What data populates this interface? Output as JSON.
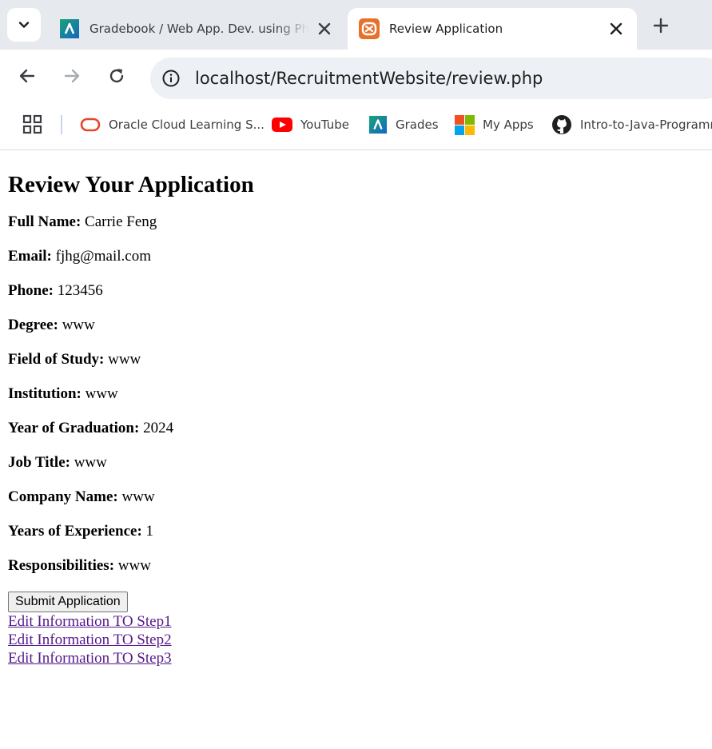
{
  "browser": {
    "tabs": [
      {
        "title": "Gradebook / Web App. Dev. using PhP",
        "active": false
      },
      {
        "title": "Review Application",
        "active": true
      }
    ],
    "address": "localhost/RecruitmentWebsite/review.php",
    "bookmarks": [
      {
        "label": "Oracle Cloud Learning S...",
        "icon": "oracle-icon"
      },
      {
        "label": "YouTube",
        "icon": "youtube-icon"
      },
      {
        "label": "Grades",
        "icon": "grades-icon"
      },
      {
        "label": "My Apps",
        "icon": "microsoft-icon"
      },
      {
        "label": "Intro-to-Java-Programming",
        "icon": "github-icon"
      }
    ]
  },
  "page": {
    "heading": "Review Your Application",
    "fields": [
      {
        "label": "Full Name:",
        "value": "Carrie Feng"
      },
      {
        "label": "Email:",
        "value": "fjhg@mail.com"
      },
      {
        "label": "Phone:",
        "value": "123456"
      },
      {
        "label": "Degree:",
        "value": "www"
      },
      {
        "label": "Field of Study:",
        "value": "www"
      },
      {
        "label": "Institution:",
        "value": "www"
      },
      {
        "label": "Year of Graduation:",
        "value": "2024"
      },
      {
        "label": "Job Title:",
        "value": "www"
      },
      {
        "label": "Company Name:",
        "value": "www"
      },
      {
        "label": "Years of Experience:",
        "value": "1"
      },
      {
        "label": "Responsibilities:",
        "value": "www"
      }
    ],
    "submit_label": "Submit Application",
    "links": [
      "Edit Information TO Step1",
      "Edit Information TO Step2",
      "Edit Information TO Step3"
    ]
  },
  "colors": {
    "link_visited": "#551a8b",
    "tabstrip_bg": "#e6e9ee",
    "omnibox_bg": "#edf0f4",
    "xampp_orange": "#e7712b",
    "youtube_red": "#ff0000"
  }
}
